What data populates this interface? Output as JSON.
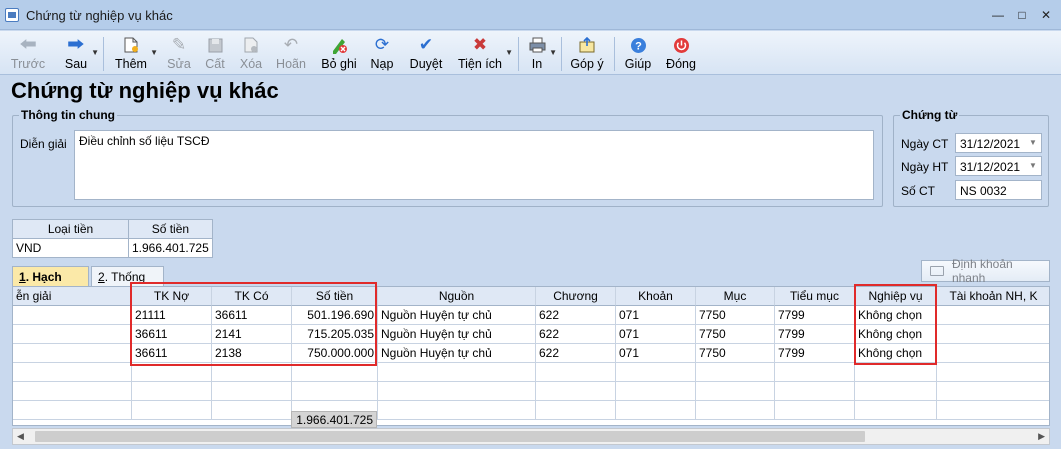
{
  "window": {
    "title": "Chứng từ nghiệp vụ khác"
  },
  "toolbar": {
    "items": [
      {
        "label": "Trước",
        "icon": "arrow-left-icon",
        "enabled": false
      },
      {
        "label": "Sau",
        "icon": "arrow-right-icon",
        "enabled": true
      },
      {
        "label": "Thêm",
        "icon": "new-document-icon",
        "enabled": true
      },
      {
        "label": "Sửa",
        "icon": "edit-icon",
        "enabled": false
      },
      {
        "label": "Cất",
        "icon": "save-icon",
        "enabled": false
      },
      {
        "label": "Xóa",
        "icon": "delete-icon",
        "enabled": false
      },
      {
        "label": "Hoãn",
        "icon": "undo-icon",
        "enabled": false
      },
      {
        "label": "Bỏ ghi",
        "icon": "unpost-icon",
        "enabled": true
      },
      {
        "label": "Nạp",
        "icon": "refresh-icon",
        "enabled": true
      },
      {
        "label": "Duyệt",
        "icon": "check-icon",
        "enabled": true
      },
      {
        "label": "Tiện ích",
        "icon": "tools-icon",
        "enabled": true
      },
      {
        "label": "In",
        "icon": "printer-icon",
        "enabled": true
      },
      {
        "label": "Góp ý",
        "icon": "feedback-icon",
        "enabled": true
      },
      {
        "label": "Giúp",
        "icon": "help-icon",
        "enabled": true
      },
      {
        "label": "Đóng",
        "icon": "power-icon",
        "enabled": true
      }
    ]
  },
  "page_title": "Chứng từ nghiệp vụ khác",
  "general": {
    "group_title": "Thông tin chung",
    "desc_label": "Diễn giải",
    "desc_value": "Điều chỉnh số liệu TSCĐ"
  },
  "voucher": {
    "group_title": "Chứng từ",
    "date_ct_label": "Ngày CT",
    "date_ct": "31/12/2021",
    "date_ht_label": "Ngày HT",
    "date_ht": "31/12/2021",
    "number_label": "Số CT",
    "number": "NS 0032"
  },
  "currency": {
    "headers": [
      "Loại tiền",
      "Số tiền"
    ],
    "currency": "VND",
    "amount": "1.966.401.725"
  },
  "tabs": [
    {
      "key": "1",
      "label": "Hạch toán",
      "active": true
    },
    {
      "key": "2",
      "label": "Thống kê",
      "active": false
    }
  ],
  "quick_entry_button": "Định khoản nhanh",
  "grid": {
    "columns": [
      "ễn giải",
      "TK Nợ",
      "TK Có",
      "Số tiền",
      "Nguồn",
      "Chương",
      "Khoản",
      "Mục",
      "Tiểu mục",
      "Nghiệp vụ",
      "Tài khoản NH, K"
    ],
    "rows": [
      [
        "",
        "21111",
        "36611",
        "501.196.690",
        "Nguồn Huyện tự chủ",
        "622",
        "071",
        "7750",
        "7799",
        "Không chọn",
        ""
      ],
      [
        "",
        "36611",
        "2141",
        "715.205.035",
        "Nguồn Huyện tự chủ",
        "622",
        "071",
        "7750",
        "7799",
        "Không chọn",
        ""
      ],
      [
        "",
        "36611",
        "2138",
        "750.000.000",
        "Nguồn Huyện tự chủ",
        "622",
        "071",
        "7750",
        "7799",
        "Không chọn",
        ""
      ]
    ],
    "total": "1.966.401.725"
  },
  "colors": {
    "highlight_border": "#e02a2a",
    "active_tab": "#fbe9a8"
  }
}
